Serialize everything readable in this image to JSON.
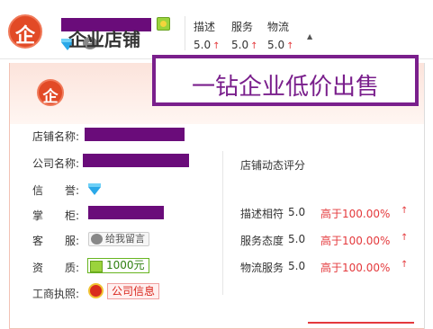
{
  "header": {
    "logo_char": "企",
    "scores": [
      {
        "label": "描述",
        "value": "5.0"
      },
      {
        "label": "服务",
        "value": "5.0"
      },
      {
        "label": "物流",
        "value": "5.0"
      }
    ],
    "up_arrow": "↑",
    "more_caret": "▲"
  },
  "card": {
    "logo_char": "企",
    "title": "企业店铺"
  },
  "promo": {
    "text": "一钻企业低价出售"
  },
  "info": {
    "shop_name_label": "店铺名称:",
    "company_label": "公司名称:",
    "credit_label": "信　　誉:",
    "owner_label": "掌　　柜:",
    "service_label": "客　　服:",
    "service_button": "给我留言",
    "qualification_label": "资　　质:",
    "qualification_value": "1000元",
    "license_label": "工商执照:",
    "license_link": "公司信息"
  },
  "dynamic": {
    "title": "店铺动态评分",
    "rows": [
      {
        "label": "描述相符",
        "score": "5.0",
        "compare": "高于100.00%",
        "arrow": "↑"
      },
      {
        "label": "服务态度",
        "score": "5.0",
        "compare": "高于100.00%",
        "arrow": "↑"
      },
      {
        "label": "物流服务",
        "score": "5.0",
        "compare": "高于100.00%",
        "arrow": "↑"
      }
    ]
  },
  "colors": {
    "brand_red": "#e24a26",
    "redaction": "#6a0c7a",
    "promo_purple": "#7a1f8c",
    "positive_red": "#e4393c"
  },
  "icons": [
    "shop-logo-icon",
    "seller-badge-icon",
    "diamond-icon",
    "wangwang-icon",
    "qualification-icon",
    "license-icon",
    "caret-up-icon"
  ]
}
